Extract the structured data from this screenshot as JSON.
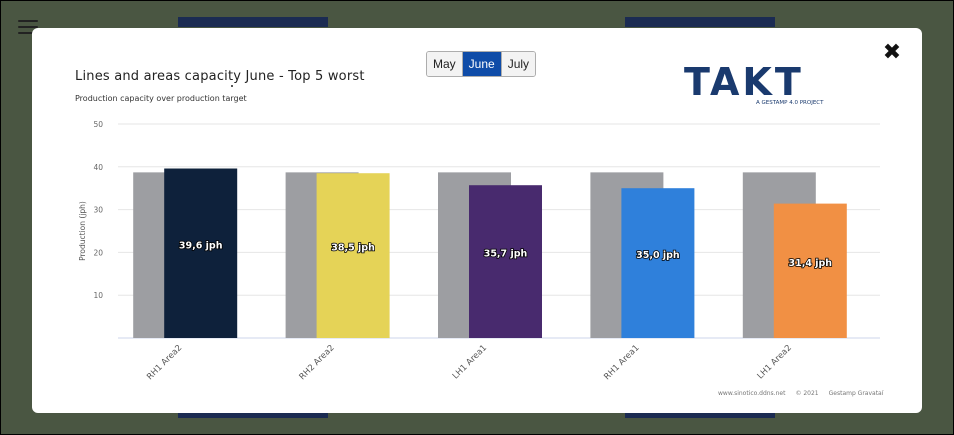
{
  "months": {
    "options": [
      "May",
      "June",
      "July"
    ],
    "selected": "June"
  },
  "close_icon": "close-icon",
  "logo": {
    "text": "TAKT",
    "tagline": "A GESTAMP 4.0 PROJECT"
  },
  "footer": {
    "site": "www.sinotico.ddns.net",
    "copyright": "© 2021",
    "company": "Gestamp Gravataí"
  },
  "chart_data": {
    "type": "bar",
    "title": "Lines and areas capacity June - Top 5 worst",
    "subtitle": "Production capacity over production target",
    "ylabel": "Production (jph)",
    "xlabel": "",
    "ylim": [
      0,
      50
    ],
    "yticks": [
      10,
      20,
      30,
      40,
      50
    ],
    "grid": true,
    "categories": [
      "RH1 Area2",
      "RH2 Area2",
      "LH1 Area1",
      "RH1 Area1",
      "LH1 Area2"
    ],
    "series": [
      {
        "role": "target",
        "values": [
          38.7,
          38.7,
          38.7,
          38.7,
          38.7
        ],
        "color": "#9d9ea2"
      },
      {
        "role": "capacity",
        "values": [
          39.6,
          38.5,
          35.7,
          35.0,
          31.4
        ],
        "labels": [
          "39,6 jph",
          "38,5 jph",
          "35,7 jph",
          "35,0 jph",
          "31,4 jph"
        ],
        "colors": [
          "#0e213b",
          "#e5d357",
          "#482a6e",
          "#2f80db",
          "#f19044"
        ]
      }
    ]
  }
}
